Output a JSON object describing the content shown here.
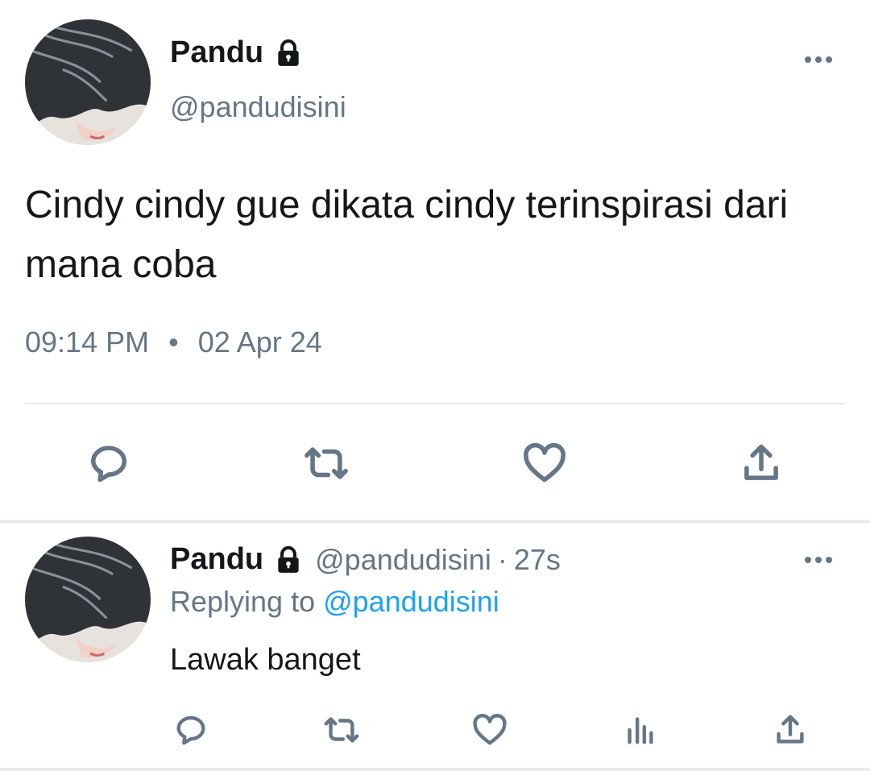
{
  "colors": {
    "text_primary": "#14171a",
    "text_secondary": "#657786",
    "link": "#1da1f2",
    "divider": "#e6ecf0"
  },
  "main_tweet": {
    "author_name": "Pandu",
    "author_handle": "@pandudisini",
    "protected_icon": "lock-icon",
    "text": "Cindy cindy gue dikata cindy terinspirasi dari mana coba",
    "time": "09:14 PM",
    "separator": "•",
    "date": "02 Apr 24",
    "actions": [
      "reply-icon",
      "retweet-icon",
      "like-icon",
      "share-icon"
    ]
  },
  "reply_tweet": {
    "author_name": "Pandu",
    "author_handle": "@pandudisini",
    "protected_icon": "lock-icon",
    "separator": "·",
    "age": "27s",
    "replying_prefix": "Replying to",
    "replying_to": "@pandudisini",
    "text": "Lawak banget",
    "actions": [
      "reply-icon",
      "retweet-icon",
      "like-icon",
      "analytics-icon",
      "share-icon"
    ]
  }
}
